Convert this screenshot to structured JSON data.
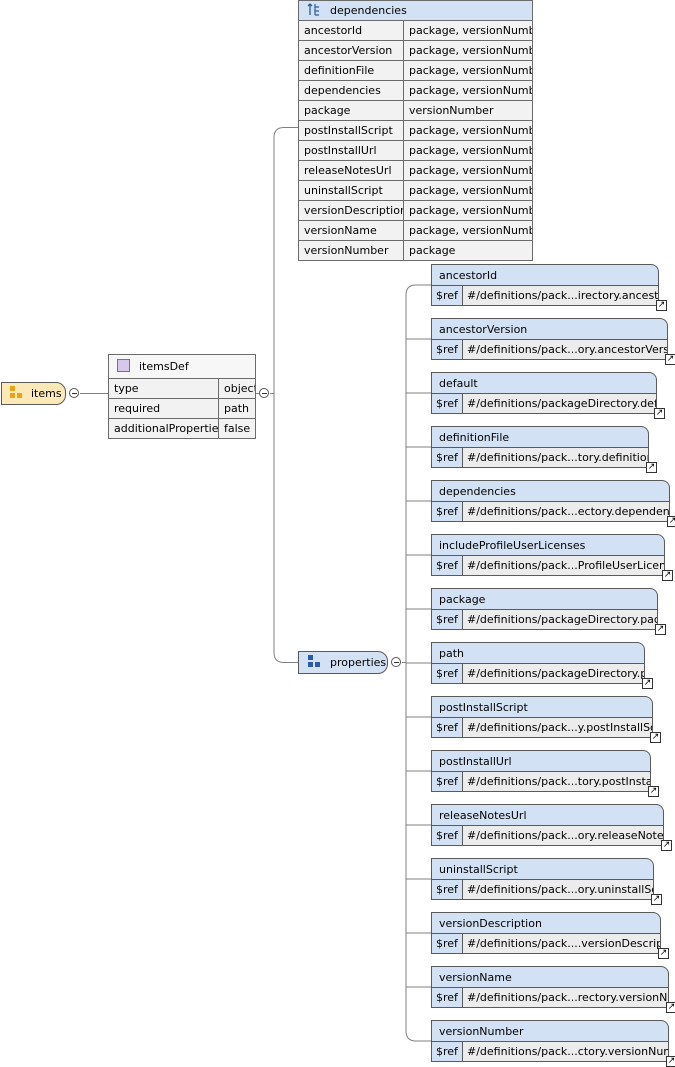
{
  "root": {
    "label": "items",
    "icon": "element-group-icon"
  },
  "itemsDef": {
    "title": "itemsDef",
    "icon": "definition-icon",
    "rows": [
      {
        "key": "type",
        "value": "object"
      },
      {
        "key": "required",
        "value": "path"
      },
      {
        "key": "additionalProperties",
        "value": "false"
      }
    ]
  },
  "dependencies": {
    "title": "dependencies",
    "icon": "dependency-tree-icon",
    "rows": [
      {
        "key": "ancestorId",
        "value": "package, versionNumber"
      },
      {
        "key": "ancestorVersion",
        "value": "package, versionNumber"
      },
      {
        "key": "definitionFile",
        "value": "package, versionNumber"
      },
      {
        "key": "dependencies",
        "value": "package, versionNumber"
      },
      {
        "key": "package",
        "value": "versionNumber"
      },
      {
        "key": "postInstallScript",
        "value": "package, versionNumber"
      },
      {
        "key": "postInstallUrl",
        "value": "package, versionNumber"
      },
      {
        "key": "releaseNotesUrl",
        "value": "package, versionNumber"
      },
      {
        "key": "uninstallScript",
        "value": "package, versionNumber"
      },
      {
        "key": "versionDescription",
        "value": "package, versionNumber"
      },
      {
        "key": "versionName",
        "value": "package, versionNumber"
      },
      {
        "key": "versionNumber",
        "value": "package"
      }
    ]
  },
  "properties": {
    "label": "properties",
    "icon": "properties-group-icon",
    "ref_key": "$ref",
    "link_icon": "external-link-arrow-icon",
    "items": [
      {
        "name": "ancestorId",
        "ref": "#/definitions/pack...irectory.ancestorId"
      },
      {
        "name": "ancestorVersion",
        "ref": "#/definitions/pack...ory.ancestorVersion"
      },
      {
        "name": "default",
        "ref": "#/definitions/packageDirectory.default"
      },
      {
        "name": "definitionFile",
        "ref": "#/definitions/pack...tory.definitionFile"
      },
      {
        "name": "dependencies",
        "ref": "#/definitions/pack...ectory.dependencies"
      },
      {
        "name": "includeProfileUserLicenses",
        "ref": "#/definitions/pack...ProfileUserLicenses"
      },
      {
        "name": "package",
        "ref": "#/definitions/packageDirectory.package"
      },
      {
        "name": "path",
        "ref": "#/definitions/packageDirectory.path"
      },
      {
        "name": "postInstallScript",
        "ref": "#/definitions/pack...y.postInstallScript"
      },
      {
        "name": "postInstallUrl",
        "ref": "#/definitions/pack...tory.postInstallUrl"
      },
      {
        "name": "releaseNotesUrl",
        "ref": "#/definitions/pack...ory.releaseNotesUrl"
      },
      {
        "name": "uninstallScript",
        "ref": "#/definitions/pack...ory.uninstallScript"
      },
      {
        "name": "versionDescription",
        "ref": "#/definitions/pack....versionDescription"
      },
      {
        "name": "versionName",
        "ref": "#/definitions/pack...rectory.versionName"
      },
      {
        "name": "versionNumber",
        "ref": "#/definitions/pack...ctory.versionNumber"
      }
    ]
  },
  "colors": {
    "element_fill": "#fde9b8",
    "property_fill": "#d3e1f5",
    "line": "#808080"
  }
}
